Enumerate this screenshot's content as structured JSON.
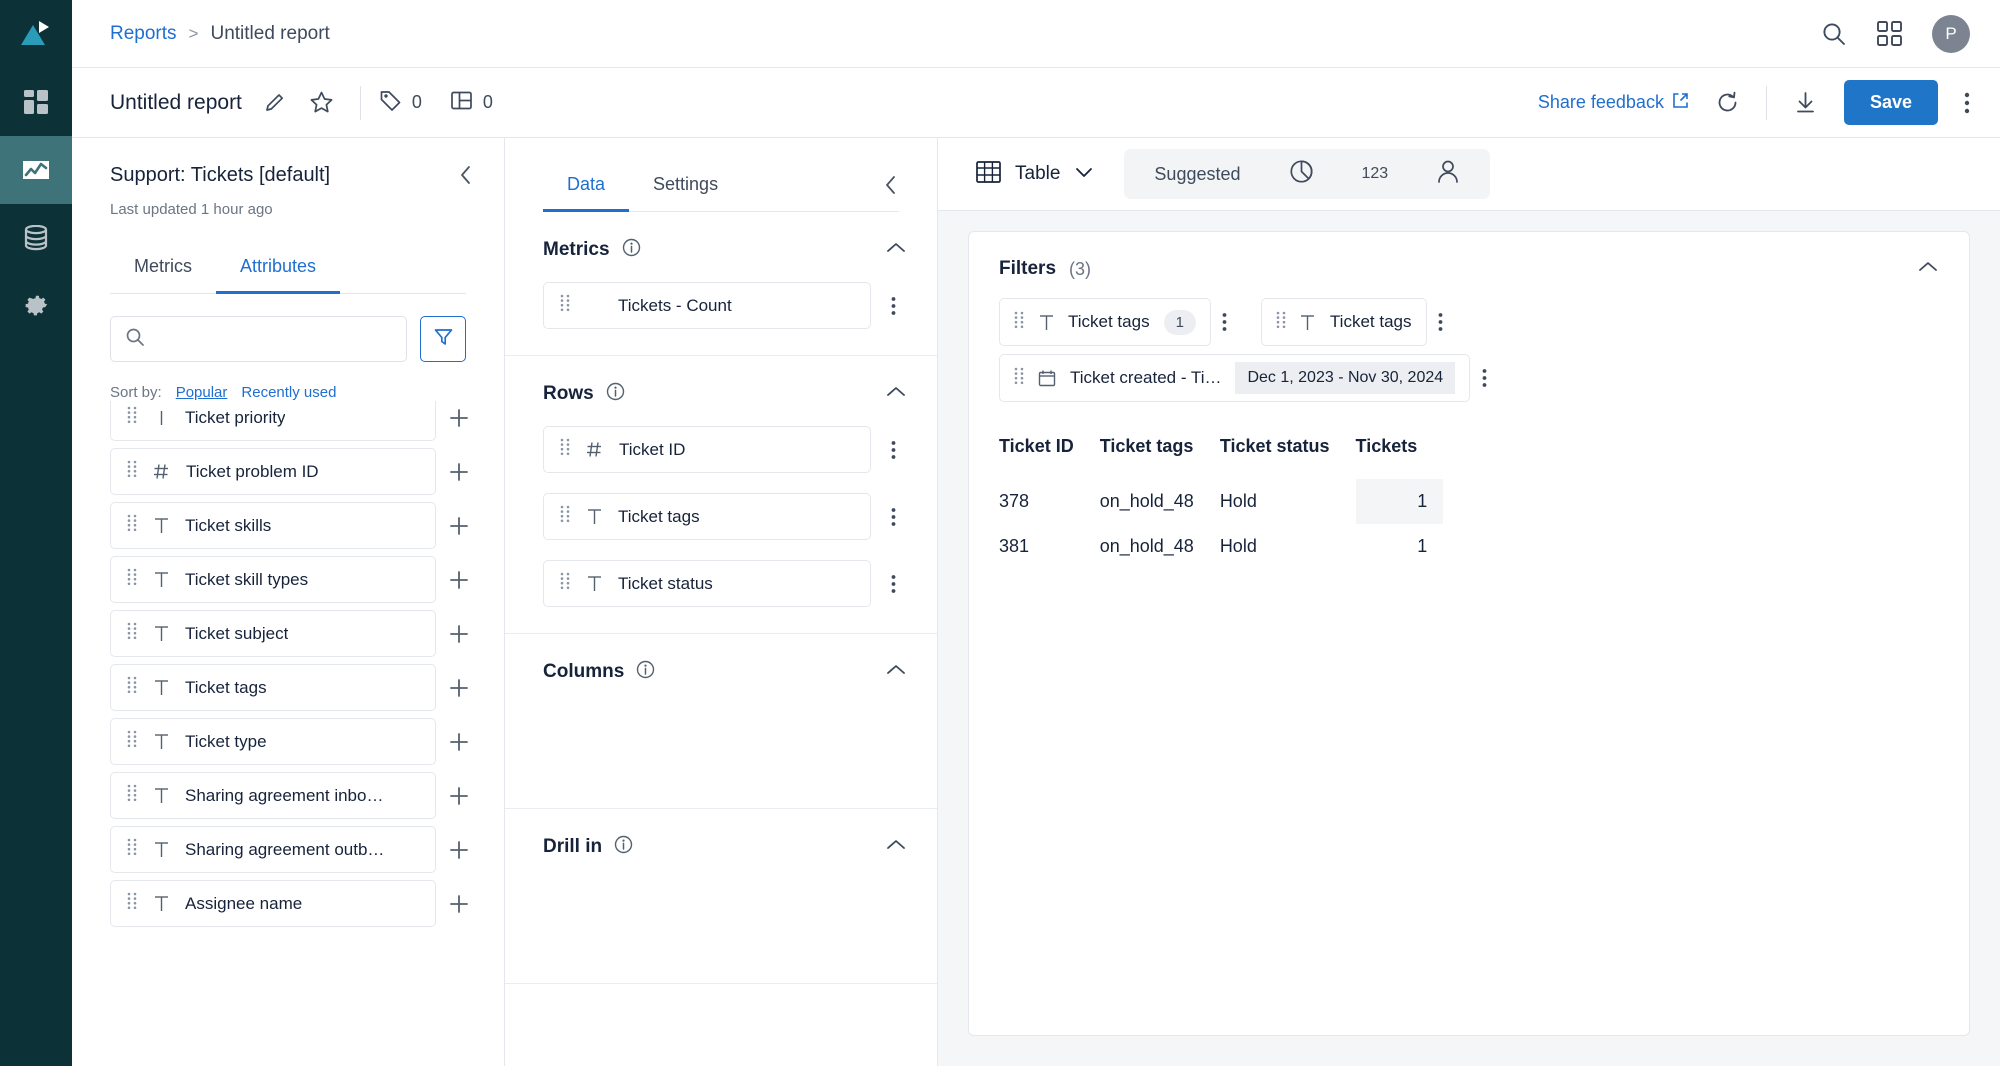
{
  "rail": {
    "logo_name": "app-logo",
    "items": [
      {
        "icon": "dashboard-grid-icon",
        "name": "rail-item-dashboards",
        "active": false
      },
      {
        "icon": "analytics-chart-icon",
        "name": "rail-item-explore",
        "active": true
      },
      {
        "icon": "database-icon",
        "name": "rail-item-datasets",
        "active": false
      },
      {
        "icon": "gear-icon",
        "name": "rail-item-settings",
        "active": false
      }
    ]
  },
  "topbar": {
    "breadcrumb_root": "Reports",
    "breadcrumb_sep": ">",
    "breadcrumb_current": "Untitled report",
    "search_icon": "search-icon",
    "apps_icon": "apps-grid-icon",
    "avatar_initial": "P"
  },
  "titlebar": {
    "report_name": "Untitled report",
    "edit_icon": "pencil-icon",
    "favorite_icon": "star-icon",
    "tag_icon": "tag-icon",
    "tag_count": "0",
    "layout_icon": "layout-icon",
    "layout_count": "0",
    "share_feedback": "Share feedback",
    "external_icon": "external-link-icon",
    "refresh_icon": "refresh-icon",
    "download_icon": "download-icon",
    "save_label": "Save",
    "more_icon": "kebab-menu-icon",
    "accent": "#1f76c8"
  },
  "fields_panel": {
    "dataset_title": "Support: Tickets [default]",
    "last_updated": "Last updated 1 hour ago",
    "collapse_icon": "chevron-left-icon",
    "tabs": [
      {
        "label": "Metrics",
        "active": false
      },
      {
        "label": "Attributes",
        "active": true
      }
    ],
    "search": {
      "value": "",
      "placeholder": "",
      "icon": "search-icon"
    },
    "filter_icon": "funnel-filter-icon",
    "sort_label": "Sort by:",
    "sort_options": [
      {
        "label": "Popular",
        "selected": true
      },
      {
        "label": "Recently used",
        "selected": false
      }
    ],
    "items": [
      {
        "label": "Ticket priority",
        "type": "|"
      },
      {
        "label": "Ticket problem ID",
        "type": "#"
      },
      {
        "label": "Ticket skills",
        "type": "T"
      },
      {
        "label": "Ticket skill types",
        "type": "T"
      },
      {
        "label": "Ticket subject",
        "type": "T"
      },
      {
        "label": "Ticket tags",
        "type": "T"
      },
      {
        "label": "Ticket type",
        "type": "T"
      },
      {
        "label": "Sharing agreement inbo…",
        "type": "T"
      },
      {
        "label": "Sharing agreement outb…",
        "type": "T"
      },
      {
        "label": "Assignee name",
        "type": "T"
      }
    ],
    "add_icon": "plus-icon"
  },
  "config_panel": {
    "tabs": [
      {
        "label": "Data",
        "active": true
      },
      {
        "label": "Settings",
        "active": false
      }
    ],
    "collapse_icon": "chevron-left-icon",
    "info_icon": "info-icon",
    "chevron_icon": "chevron-up-icon",
    "kebab_icon": "kebab-menu-icon",
    "sections": [
      {
        "title": "Metrics",
        "items": [
          {
            "label": "Tickets - Count",
            "type": ""
          }
        ]
      },
      {
        "title": "Rows",
        "items": [
          {
            "label": "Ticket ID",
            "type": "#"
          },
          {
            "label": "Ticket tags",
            "type": "T"
          },
          {
            "label": "Ticket status",
            "type": "T"
          }
        ]
      },
      {
        "title": "Columns",
        "items": []
      },
      {
        "title": "Drill in",
        "items": []
      }
    ]
  },
  "canvas": {
    "viz_type": "Table",
    "viz_icon": "table-icon",
    "viz_chevron": "chevron-down-icon",
    "suggestions": [
      {
        "label": "Suggested",
        "icon": ""
      },
      {
        "label": "",
        "icon": "pie-chart-icon"
      },
      {
        "label": "",
        "icon": "number-123-icon"
      },
      {
        "label": "",
        "icon": "person-icon"
      }
    ],
    "filters": {
      "title": "Filters",
      "count": "(3)",
      "collapse_icon": "chevron-up-icon",
      "chips": [
        {
          "label": "Ticket tags",
          "type": "T",
          "badge": "1",
          "value": ""
        },
        {
          "label": "Ticket tags",
          "type": "T",
          "badge": "",
          "value": ""
        },
        {
          "label": "Ticket created - Ti…",
          "type": "calendar",
          "badge": "",
          "value": "Dec 1, 2023 - Nov 30, 2024"
        }
      ]
    },
    "chart_data": {
      "type": "table",
      "title": "",
      "columns": [
        "Ticket ID",
        "Ticket tags",
        "Ticket status",
        "Tickets"
      ],
      "column_align": [
        "left",
        "left",
        "left",
        "right"
      ],
      "rows": [
        [
          "378",
          "on_hold_48",
          "Hold",
          "1"
        ],
        [
          "381",
          "on_hold_48",
          "Hold",
          "1"
        ]
      ],
      "highlighted_cell": {
        "row": 0,
        "col": 3
      }
    }
  }
}
